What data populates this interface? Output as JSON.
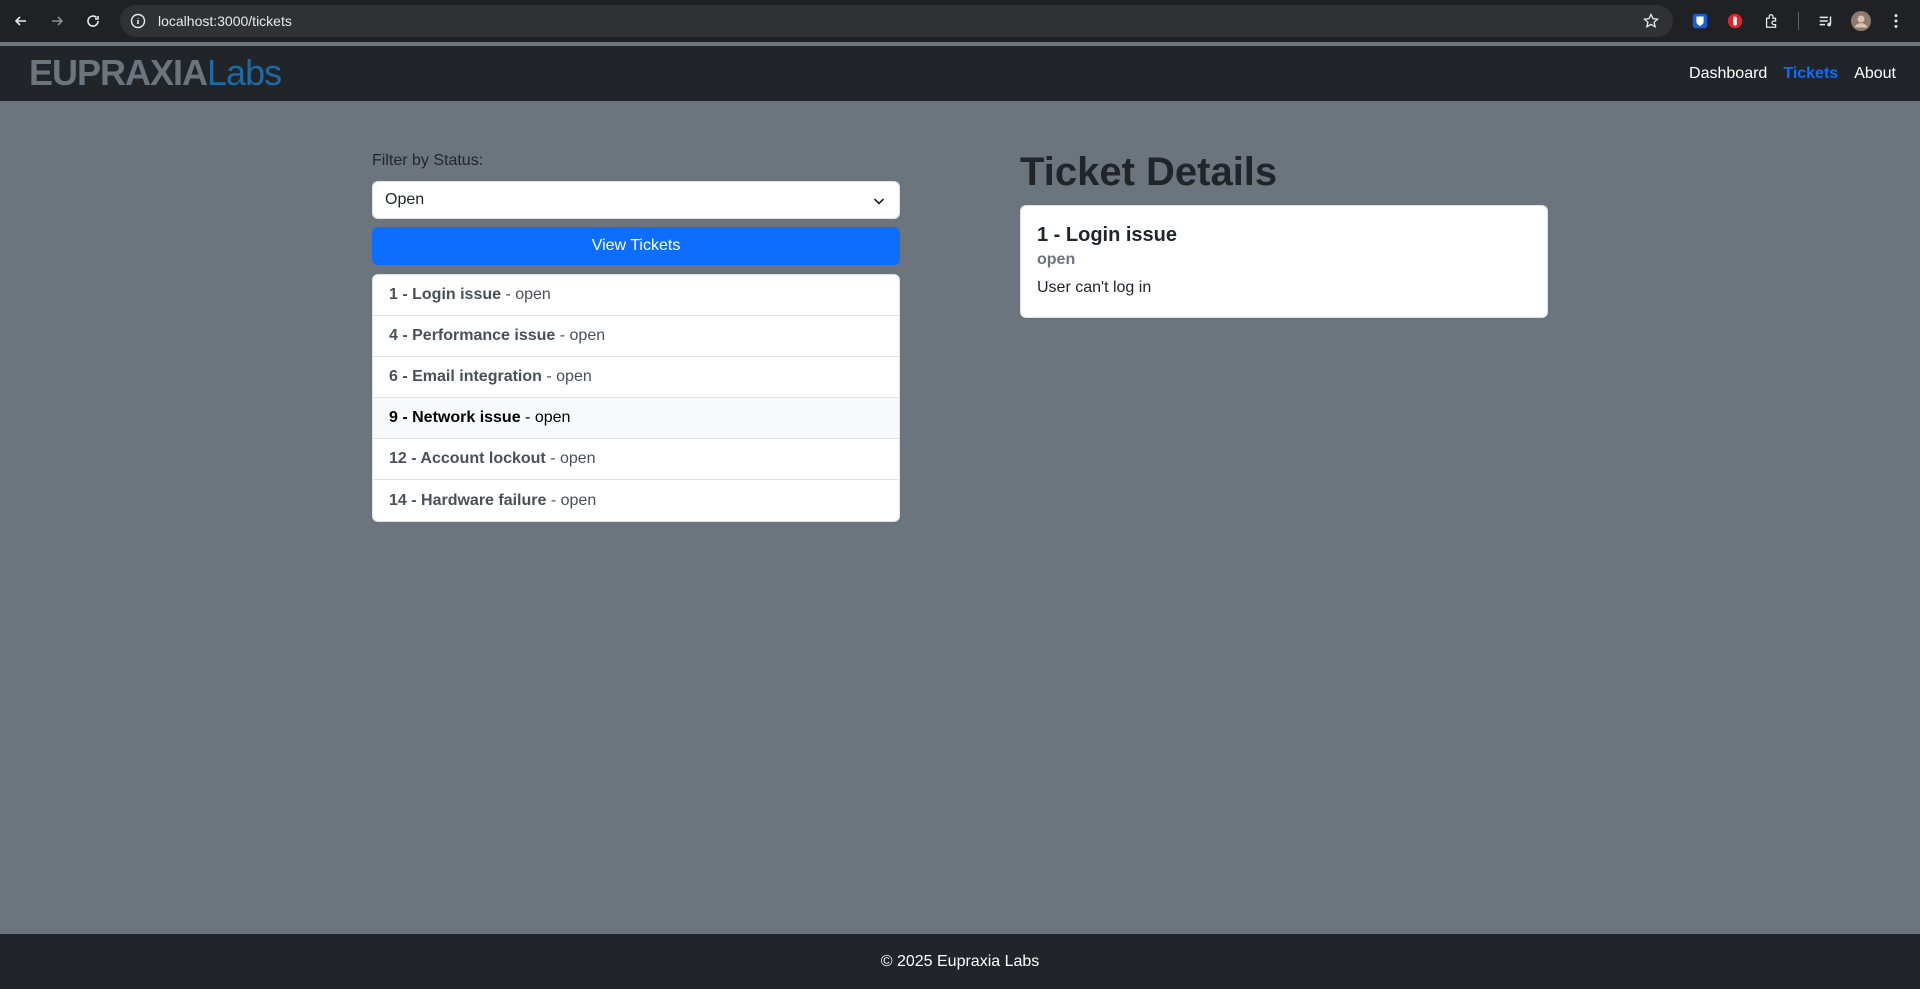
{
  "browser": {
    "url": "localhost:3000/tickets"
  },
  "navbar": {
    "logo_part1": "EUPRAXIA",
    "logo_part2": "Labs",
    "links": [
      {
        "label": "Dashboard"
      },
      {
        "label": "Tickets"
      },
      {
        "label": "About"
      }
    ]
  },
  "filter": {
    "label": "Filter by Status:",
    "selected": "Open",
    "button_label": "View Tickets"
  },
  "tickets": [
    {
      "title": "1 - Login issue",
      "status": " - open"
    },
    {
      "title": "4 - Performance issue",
      "status": " - open"
    },
    {
      "title": "6 - Email integration",
      "status": " - open"
    },
    {
      "title": "9 - Network issue",
      "status": " - open"
    },
    {
      "title": "12 - Account lockout",
      "status": " - open"
    },
    {
      "title": "14 - Hardware failure",
      "status": " - open"
    }
  ],
  "details": {
    "heading": "Ticket Details",
    "title": "1 - Login issue",
    "status": "open",
    "description": "User can't log in"
  },
  "footer": {
    "text": "© 2025 Eupraxia Labs"
  },
  "colors": {
    "primary": "#0d6efd",
    "navbar": "#212529",
    "page_bg": "#6c757d"
  }
}
